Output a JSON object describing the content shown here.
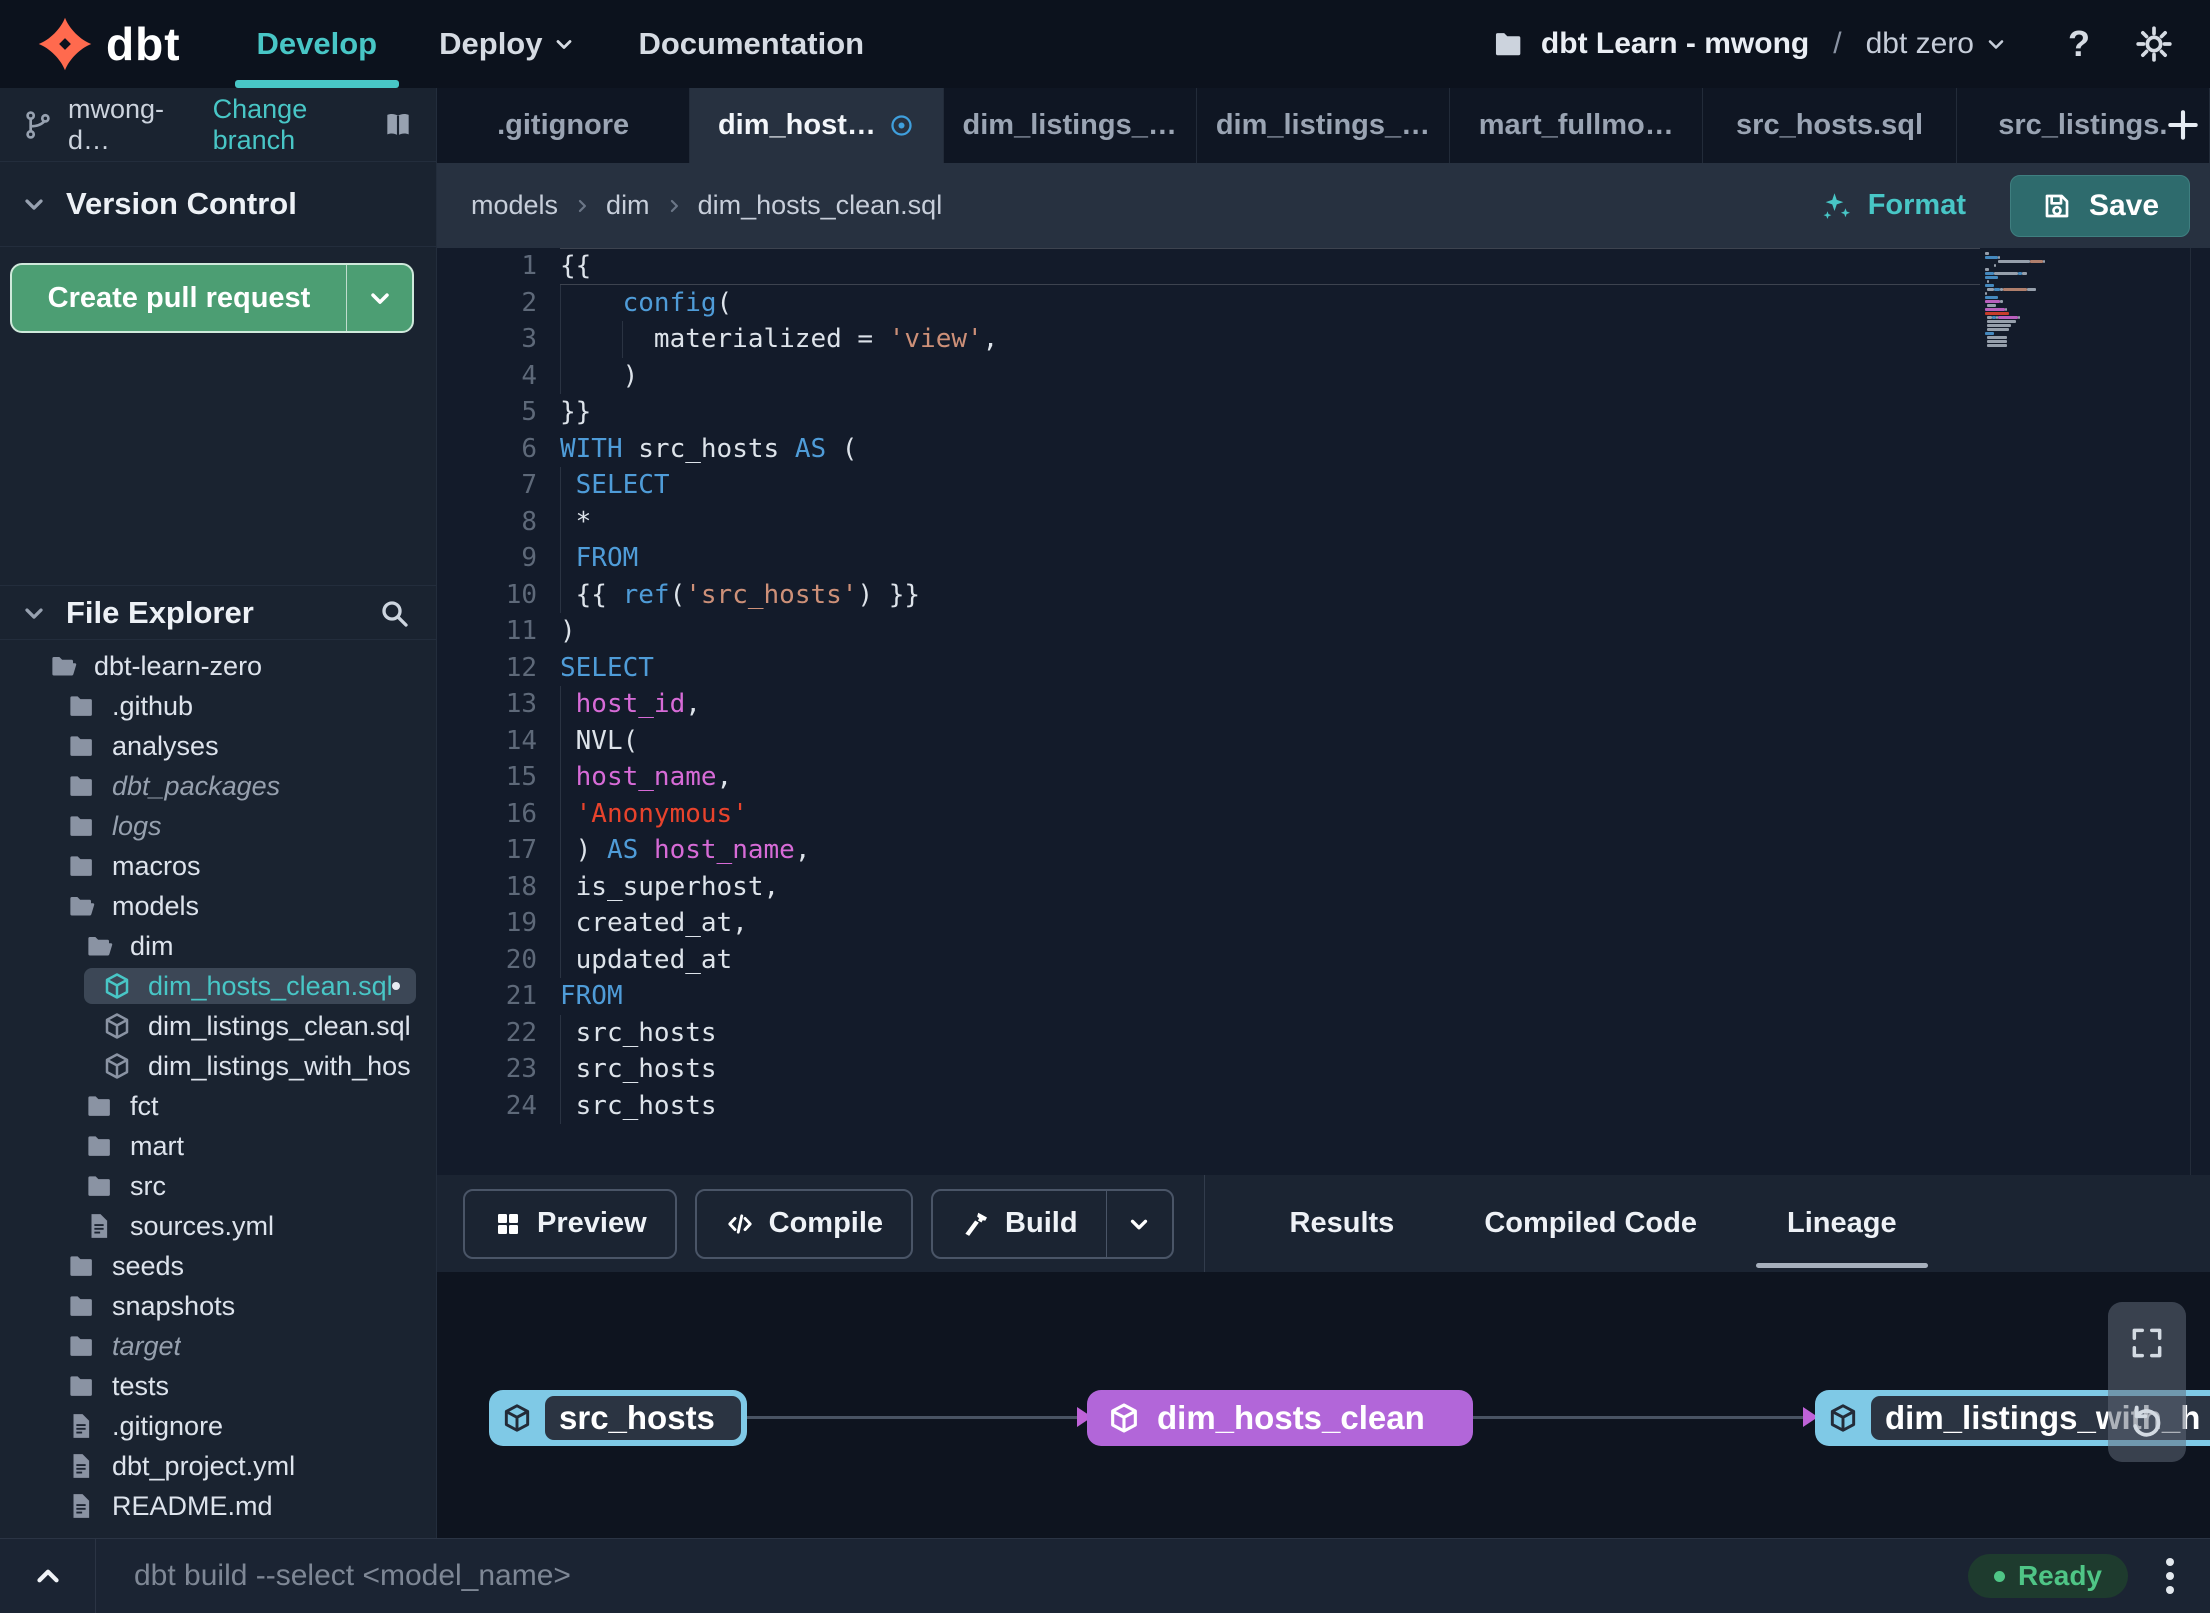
{
  "colors": {
    "accent_teal": "#48c6c6",
    "brand_orange": "#ff6a4e",
    "button_green": "#4c9e73",
    "save_teal": "#2e6b6d",
    "keyword_blue": "#4f9cd8",
    "string_salmon": "#cd9078",
    "string_red": "#e8432c",
    "identifier_magenta": "#d76bd7",
    "node_blue": "#7fc9e6",
    "node_purple": "#b266d9",
    "ready_green": "#4fc586"
  },
  "navbar": {
    "brand": "dbt",
    "menus": [
      {
        "label": "Develop",
        "active": true
      },
      {
        "label": "Deploy",
        "has_dropdown": true
      },
      {
        "label": "Documentation"
      }
    ],
    "project_breadcrumb": {
      "account": "dbt Learn - mwong",
      "separator": "/",
      "project": "dbt zero"
    },
    "help_label": "?"
  },
  "sidebar": {
    "branch": {
      "name": "mwong-d…",
      "change_action": "Change branch"
    },
    "version_control": {
      "title": "Version Control",
      "create_pr_label": "Create pull request"
    },
    "file_explorer": {
      "title": "File Explorer",
      "tree": [
        {
          "label": "dbt-learn-zero",
          "level": 0,
          "icon": "folder-open"
        },
        {
          "label": ".github",
          "level": 1,
          "icon": "folder"
        },
        {
          "label": "analyses",
          "level": 1,
          "icon": "folder"
        },
        {
          "label": "dbt_packages",
          "level": 1,
          "icon": "folder",
          "italic": true
        },
        {
          "label": "logs",
          "level": 1,
          "icon": "folder",
          "italic": true
        },
        {
          "label": "macros",
          "level": 1,
          "icon": "folder"
        },
        {
          "label": "models",
          "level": 1,
          "icon": "folder-open"
        },
        {
          "label": "dim",
          "level": 2,
          "icon": "folder-open"
        },
        {
          "label": "dim_hosts_clean.sql",
          "level": 3,
          "icon": "model",
          "selected": true,
          "modified": true
        },
        {
          "label": "dim_listings_clean.sql",
          "level": 3,
          "icon": "model"
        },
        {
          "label": "dim_listings_with_hosts…",
          "level": 3,
          "icon": "model"
        },
        {
          "label": "fct",
          "level": 2,
          "icon": "folder"
        },
        {
          "label": "mart",
          "level": 2,
          "icon": "folder"
        },
        {
          "label": "src",
          "level": 2,
          "icon": "folder"
        },
        {
          "label": "sources.yml",
          "level": 2,
          "icon": "file"
        },
        {
          "label": "seeds",
          "level": 1,
          "icon": "folder"
        },
        {
          "label": "snapshots",
          "level": 1,
          "icon": "folder"
        },
        {
          "label": "target",
          "level": 1,
          "icon": "folder",
          "italic": true
        },
        {
          "label": "tests",
          "level": 1,
          "icon": "folder"
        },
        {
          "label": ".gitignore",
          "level": 1,
          "icon": "file"
        },
        {
          "label": "dbt_project.yml",
          "level": 1,
          "icon": "file"
        },
        {
          "label": "README.md",
          "level": 1,
          "icon": "file"
        }
      ]
    }
  },
  "editor_tabs": {
    "items": [
      {
        "label": ".gitignore"
      },
      {
        "label": "dim_host…",
        "active": true,
        "modified": true
      },
      {
        "label": "dim_listings_…"
      },
      {
        "label": "dim_listings_…"
      },
      {
        "label": "mart_fullmo…"
      },
      {
        "label": "src_hosts.sql"
      },
      {
        "label": "src_listings."
      }
    ],
    "add_label": "+"
  },
  "editor": {
    "breadcrumb": [
      "models",
      "dim",
      "dim_hosts_clean.sql"
    ],
    "format_label": "Format",
    "save_label": "Save",
    "code_lines": [
      [
        [
          "p",
          "{{"
        ]
      ],
      [
        [
          "p",
          "    "
        ],
        [
          "k",
          "config"
        ],
        [
          "p",
          "("
        ]
      ],
      [
        [
          "p",
          "      materialized = "
        ],
        [
          "s",
          "'view'"
        ],
        [
          "p",
          ","
        ]
      ],
      [
        [
          "p",
          "    )"
        ]
      ],
      [
        [
          "p",
          "}}"
        ]
      ],
      [
        [
          "k",
          "WITH"
        ],
        [
          "p",
          " src_hosts "
        ],
        [
          "k",
          "AS"
        ],
        [
          "p",
          " ("
        ]
      ],
      [
        [
          "p",
          " "
        ],
        [
          "k",
          "SELECT"
        ]
      ],
      [
        [
          "p",
          " *"
        ]
      ],
      [
        [
          "p",
          " "
        ],
        [
          "k",
          "FROM"
        ]
      ],
      [
        [
          "p",
          " {{ "
        ],
        [
          "k",
          "ref"
        ],
        [
          "p",
          "("
        ],
        [
          "s",
          "'src_hosts'"
        ],
        [
          "p",
          ") }}"
        ]
      ],
      [
        [
          "p",
          ")"
        ]
      ],
      [
        [
          "k",
          "SELECT"
        ]
      ],
      [
        [
          "p",
          " "
        ],
        [
          "m",
          "host_id"
        ],
        [
          "p",
          ","
        ]
      ],
      [
        [
          "p",
          " NVL("
        ]
      ],
      [
        [
          "p",
          " "
        ],
        [
          "m",
          "host_name"
        ],
        [
          "p",
          ","
        ]
      ],
      [
        [
          "p",
          " "
        ],
        [
          "r",
          "'Anonymous'"
        ]
      ],
      [
        [
          "p",
          " ) "
        ],
        [
          "k",
          "AS"
        ],
        [
          "p",
          " "
        ],
        [
          "m",
          "host_name"
        ],
        [
          "p",
          ","
        ]
      ],
      [
        [
          "p",
          " is_superhost,"
        ]
      ],
      [
        [
          "p",
          " created_at,"
        ]
      ],
      [
        [
          "p",
          " updated_at"
        ]
      ],
      [
        [
          "k",
          "FROM"
        ]
      ],
      [
        [
          "p",
          " src_hosts"
        ]
      ],
      [
        [
          "p",
          " src_hosts"
        ]
      ],
      [
        [
          "p",
          " src_hosts"
        ]
      ]
    ]
  },
  "bottom_panel": {
    "buttons": [
      {
        "label": "Preview",
        "icon": "grid"
      },
      {
        "label": "Compile",
        "icon": "code"
      },
      {
        "label": "Build",
        "icon": "hammer",
        "has_dropdown": true
      }
    ],
    "tabs": [
      {
        "label": "Results"
      },
      {
        "label": "Compiled Code"
      },
      {
        "label": "Lineage",
        "active": true
      }
    ]
  },
  "lineage": {
    "nodes": [
      {
        "label": "src_hosts",
        "kind": "source"
      },
      {
        "label": "dim_hosts_clean",
        "kind": "selected"
      },
      {
        "label": "dim_listings_with_h",
        "kind": "source"
      }
    ],
    "edges": [
      {
        "from": "src_hosts",
        "to": "dim_hosts_clean"
      },
      {
        "from": "dim_hosts_clean",
        "to": "dim_listings_with_h"
      }
    ]
  },
  "command_bar": {
    "placeholder": "dbt build --select <model_name>",
    "status": "Ready"
  }
}
